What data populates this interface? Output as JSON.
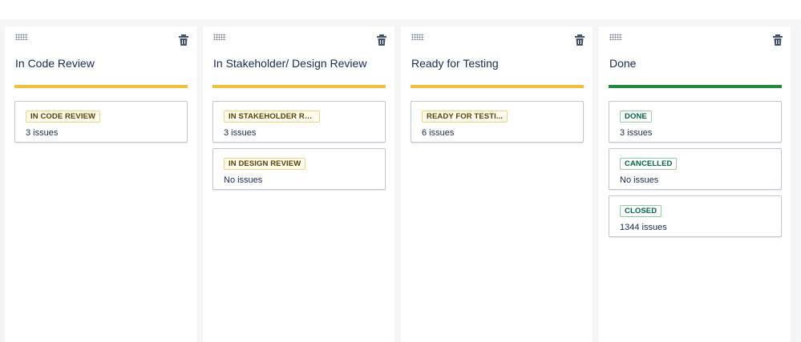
{
  "colors": {
    "in_progress_bar": "#f0c23b",
    "done_bar": "#1e8a3e",
    "yellow_badge": "#594300",
    "green_badge": "#006644"
  },
  "columns": [
    {
      "title": "In Code Review",
      "bar_color": "#f0c23b",
      "cards": [
        {
          "status": "IN CODE REVIEW",
          "count": "3 issues",
          "tone": "yellow"
        }
      ]
    },
    {
      "title": "In Stakeholder/ Design Review",
      "bar_color": "#f0c23b",
      "cards": [
        {
          "status": "IN STAKEHOLDER REVI...",
          "count": "3 issues",
          "tone": "yellow"
        },
        {
          "status": "IN DESIGN REVIEW",
          "count": "No issues",
          "tone": "yellow"
        }
      ]
    },
    {
      "title": "Ready for Testing",
      "bar_color": "#f0c23b",
      "cards": [
        {
          "status": "READY FOR TESTI...",
          "count": "6 issues",
          "tone": "yellow"
        }
      ]
    },
    {
      "title": "Done",
      "bar_color": "#1e8a3e",
      "cards": [
        {
          "status": "DONE",
          "count": "3 issues",
          "tone": "green"
        },
        {
          "status": "CANCELLED",
          "count": "No issues",
          "tone": "green"
        },
        {
          "status": "CLOSED",
          "count": "1344 issues",
          "tone": "green"
        }
      ]
    }
  ],
  "icons": {
    "drag": "drag-handle-icon",
    "delete": "trash-icon"
  }
}
